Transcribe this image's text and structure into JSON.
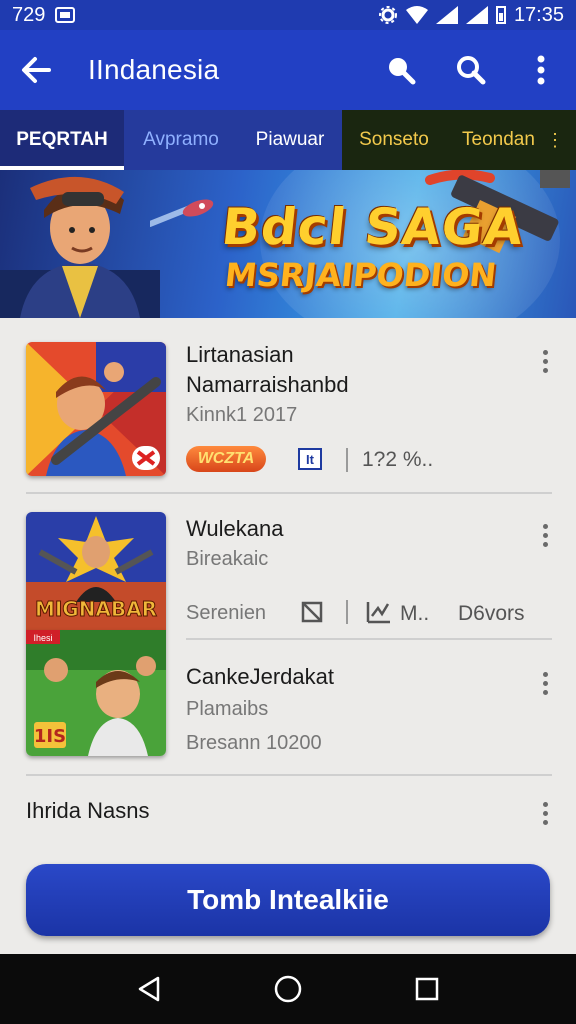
{
  "status_bar": {
    "time_left": "729",
    "time_right": "17:35"
  },
  "app_bar": {
    "title": "IIndanesia"
  },
  "tabs": [
    {
      "label": "PEQRTAH"
    },
    {
      "label": "Avpramo"
    },
    {
      "label": "Piawuar"
    },
    {
      "label": "Sonseto"
    },
    {
      "label": "Teondan"
    }
  ],
  "banner": {
    "line1": "Bdcl SAGA",
    "line2": "MSRJAIPODION"
  },
  "items": [
    {
      "title": "Lirtanasian",
      "title2": "Namarraishanbd",
      "meta": "Kinnk1  2017",
      "badge": "WCZTA",
      "badge2": "It",
      "stat": "1?2 %.."
    },
    {
      "title": "Wulekana",
      "subtitle": "Bireakaic",
      "meta": "Serenien",
      "stat1": "M..",
      "stat2": "D6vors",
      "thumb_text": "MIGNABAR"
    },
    {
      "title": "CankeJerdakat",
      "subtitle": "Plamaibs",
      "meta": "Bresann 10200",
      "thumb_text": "1IS",
      "thumb_tag": "Ihesi"
    }
  ],
  "section": {
    "label": "Ihrida Nasns"
  },
  "cta": {
    "label": "Tomb Intealkiie"
  },
  "colors": {
    "primary": "#2240c4",
    "accent": "#ffcf2e",
    "background": "#ecebe9"
  }
}
